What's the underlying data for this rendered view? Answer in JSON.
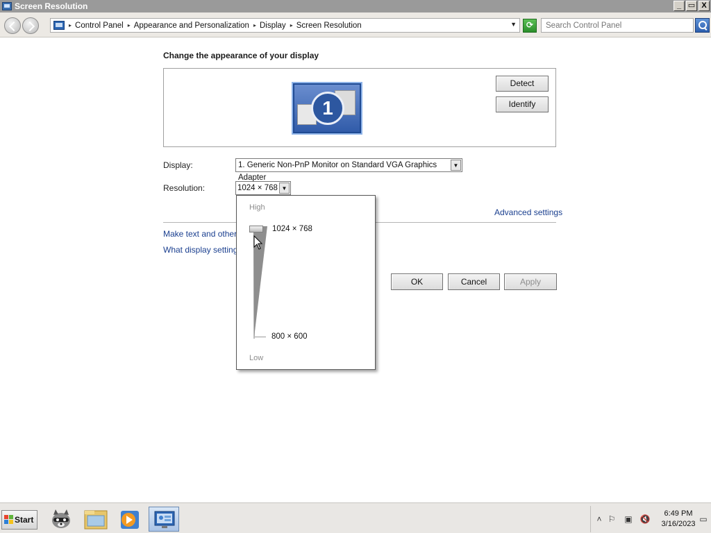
{
  "window": {
    "title": "Screen Resolution",
    "buttons": [
      "_",
      "▭",
      "X"
    ]
  },
  "address": {
    "breadcrumbs": [
      "Control Panel",
      "Appearance and Personalization",
      "Display",
      "Screen Resolution"
    ],
    "search_placeholder": "Search Control Panel"
  },
  "main": {
    "heading": "Change the appearance of your display",
    "monitor_number": "1",
    "detect_label": "Detect",
    "identify_label": "Identify",
    "display_label": "Display:",
    "display_value": "1. Generic Non-PnP Monitor on Standard VGA Graphics Adapter",
    "resolution_label": "Resolution:",
    "resolution_value": "1024 × 768",
    "advanced_link": "Advanced settings",
    "link_text_size": "Make text and other it",
    "link_which_settings": "What display settings",
    "ok_label": "OK",
    "cancel_label": "Cancel",
    "apply_label": "Apply"
  },
  "resolution_popup": {
    "high_label": "High",
    "low_label": "Low",
    "options": [
      "1024 × 768",
      "800 × 600"
    ],
    "selected": "1024 × 768"
  },
  "taskbar": {
    "start_label": "Start",
    "pinned": [
      "raccoon-app-icon",
      "folder-icon",
      "media-player-icon",
      "control-panel-icon"
    ],
    "time": "6:49 PM",
    "date": "3/16/2023"
  }
}
